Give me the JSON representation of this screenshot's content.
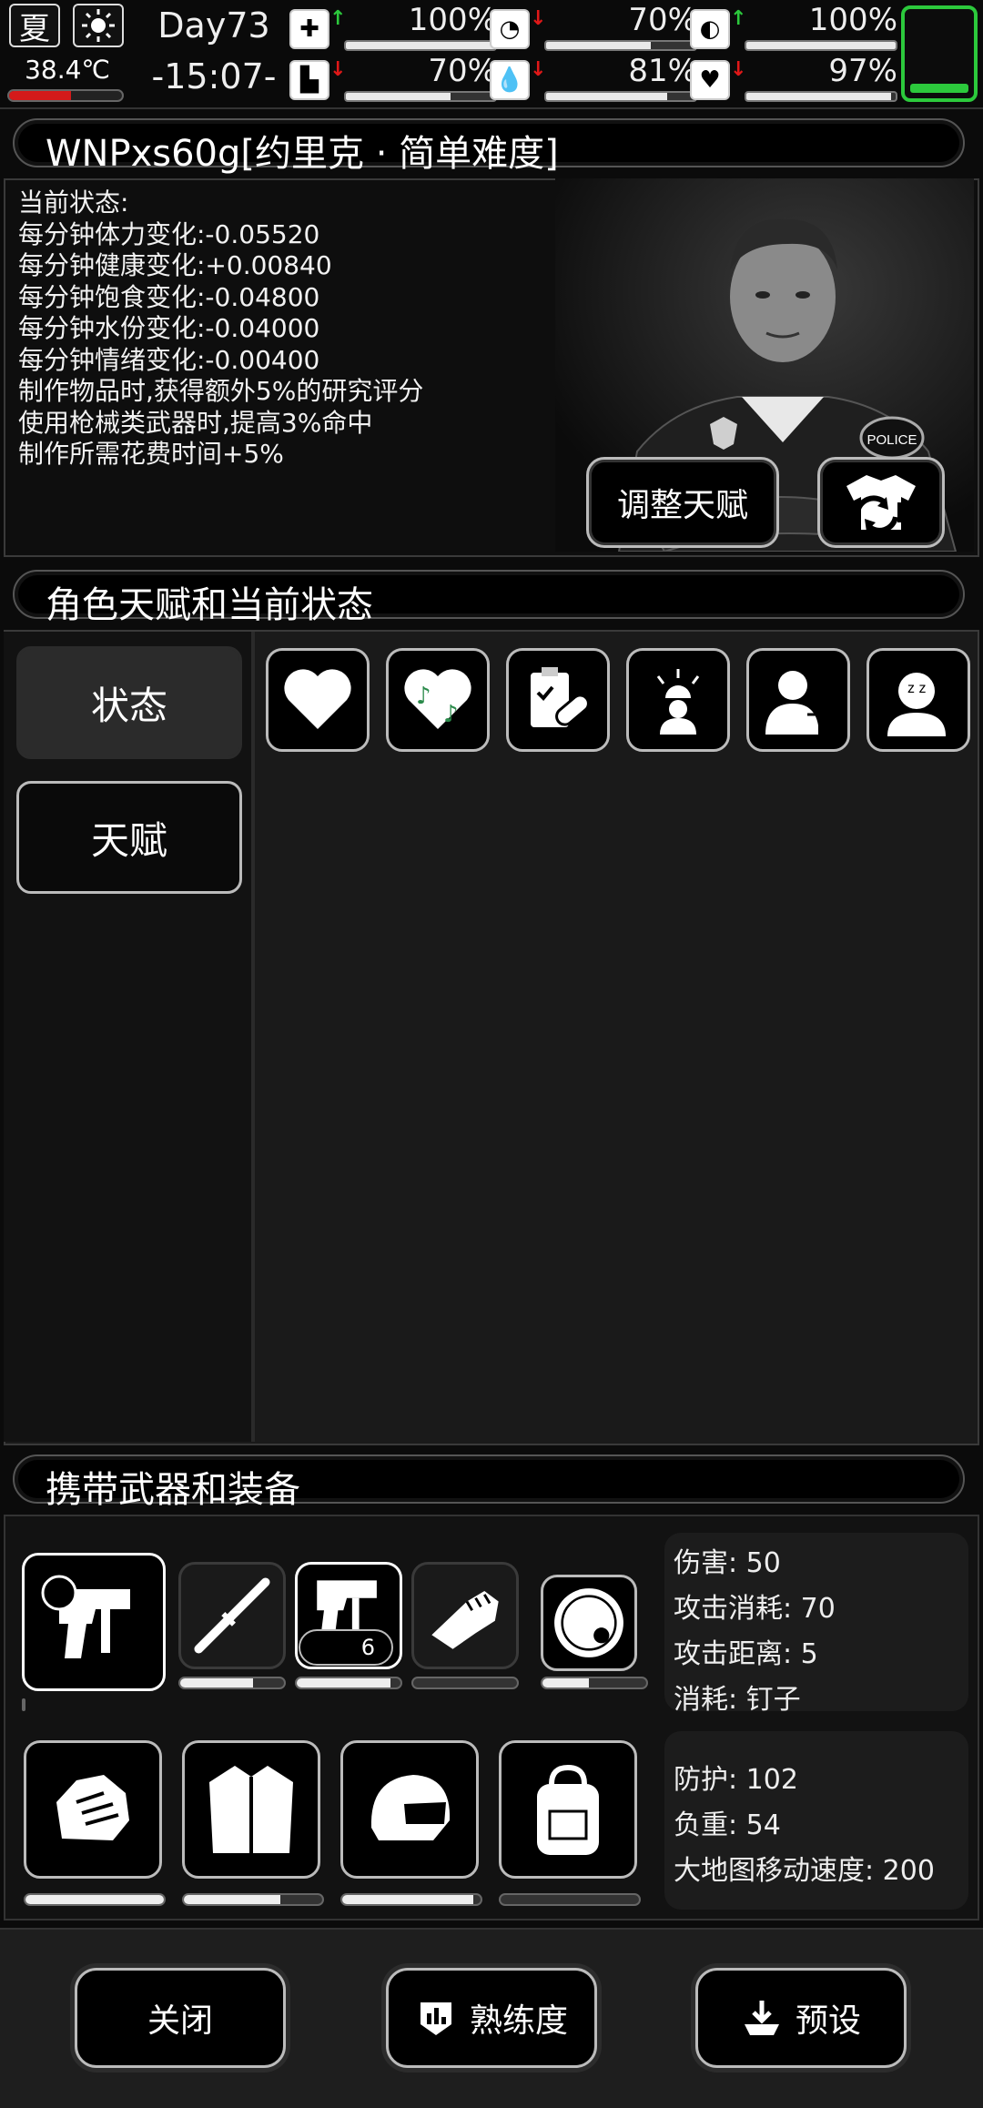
{
  "status_bar": {
    "season": "夏",
    "weather_icon": "sun-icon",
    "temperature": "38.4℃",
    "temperature_level": 0.55,
    "day": "Day73",
    "time": "-15:07-",
    "stats": [
      {
        "name": "health",
        "icon": "medkit-icon",
        "trend": "up",
        "value": "100%",
        "level": 1.0
      },
      {
        "name": "stamina",
        "icon": "boot-icon",
        "trend": "down",
        "value": "70%",
        "level": 0.7
      },
      {
        "name": "hunger",
        "icon": "stomach-icon",
        "trend": "down",
        "value": "70%",
        "level": 0.7
      },
      {
        "name": "water",
        "icon": "water-drop-icon",
        "trend": "down",
        "value": "81%",
        "level": 0.81
      },
      {
        "name": "medicine",
        "icon": "pill-icon",
        "trend": "up",
        "value": "100%",
        "level": 1.0
      },
      {
        "name": "mood",
        "icon": "heart-icon",
        "trend": "down",
        "value": "97%",
        "level": 0.97
      }
    ],
    "battery_color": "#2cc93c"
  },
  "character": {
    "title": "WNPxs60g[约里克 · 简单难度]",
    "status_heading": "当前状态:",
    "status_lines": [
      "每分钟体力变化:-0.05520",
      "每分钟健康变化:+0.00840",
      "每分钟饱食变化:-0.04800",
      "每分钟水份变化:-0.04000",
      "每分钟情绪变化:-0.00400",
      "制作物品时,获得额外5%的研究评分",
      "使用枪械类武器时,提高3%命中",
      "制作所需花费时间+5%"
    ],
    "portrait_badge": "POLICE",
    "adjust_talent_label": "调整天赋"
  },
  "talents_section": {
    "title": "角色天赋和当前状态",
    "tabs": [
      {
        "label": "状态",
        "active": true
      },
      {
        "label": "天赋",
        "active": false
      }
    ],
    "status_icons": [
      "heart-icon",
      "music-heart-icon",
      "clipboard-pill-icon",
      "alarm-person-icon",
      "person-heartbeat-icon",
      "person-sleep-icon"
    ]
  },
  "equipment_section": {
    "title": "携带武器和装备",
    "weapons": [
      {
        "icon": "nail-gun-icon",
        "durability": 1.0,
        "selected": true
      },
      {
        "icon": "baton-icon",
        "durability": 0.7
      },
      {
        "icon": "nail-gun-alt-icon",
        "durability": 0.9,
        "ammo": "6"
      },
      {
        "icon": "fist-icon",
        "durability": 0.0
      },
      {
        "icon": "shield-icon",
        "durability": 0.45
      }
    ],
    "weapon_stats": [
      "伤害: 50",
      "攻击消耗: 70",
      "攻击距离: 5",
      "消耗: 钉子"
    ],
    "armor": [
      {
        "icon": "gloves-icon",
        "durability": 1.0
      },
      {
        "icon": "coat-icon",
        "durability": 0.7
      },
      {
        "icon": "helmet-icon",
        "durability": 0.95
      },
      {
        "icon": "backpack-icon",
        "durability": 0.0
      }
    ],
    "armor_stats": [
      "防护: 102",
      "负重: 54",
      "大地图移动速度: 200"
    ]
  },
  "footer": {
    "close_label": "关闭",
    "proficiency_label": "熟练度",
    "preset_label": "预设"
  }
}
